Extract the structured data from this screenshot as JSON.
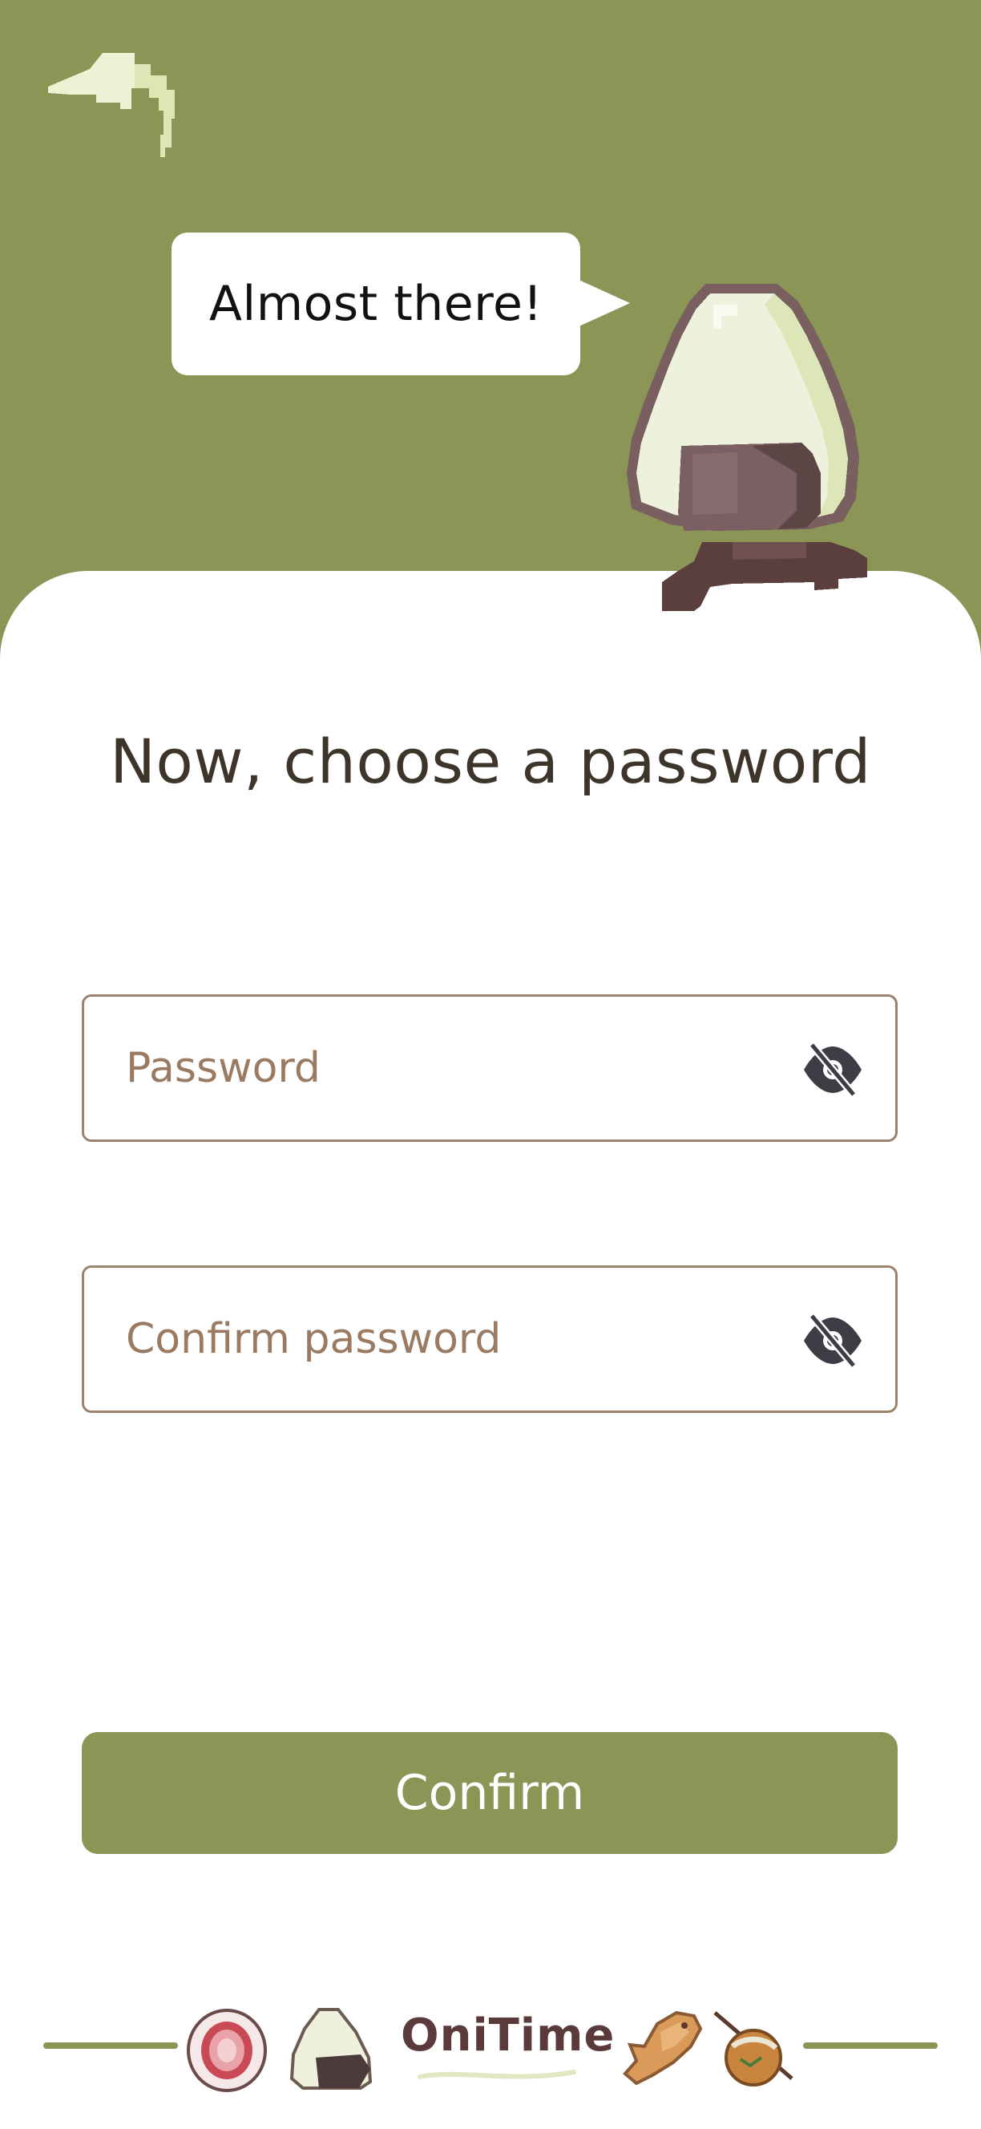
{
  "speech_bubble": {
    "text": "Almost there!"
  },
  "title": "Now, choose a password",
  "password_field": {
    "placeholder": "Password",
    "value": ""
  },
  "confirm_password_field": {
    "placeholder": "Confirm password",
    "value": ""
  },
  "confirm_button": {
    "label": "Confirm"
  },
  "footer": {
    "brand": "OniTime"
  },
  "icons": {
    "back": "back-arrow-icon",
    "visibility": "eye-slash-icon",
    "mascot": "onigiri-mascot",
    "footer_left": [
      "strawberry-daifuku-icon",
      "onigiri-icon"
    ],
    "footer_right": [
      "taiyaki-icon",
      "takoyaki-icon"
    ]
  },
  "colors": {
    "accent": "#8b9656",
    "text": "#3d3529",
    "placeholder": "#9a7b62",
    "field_border": "#9a836e",
    "mascot_body": "#eef2dc",
    "mascot_outline": "#7a5f60",
    "mascot_nori": "#7a5f63"
  }
}
